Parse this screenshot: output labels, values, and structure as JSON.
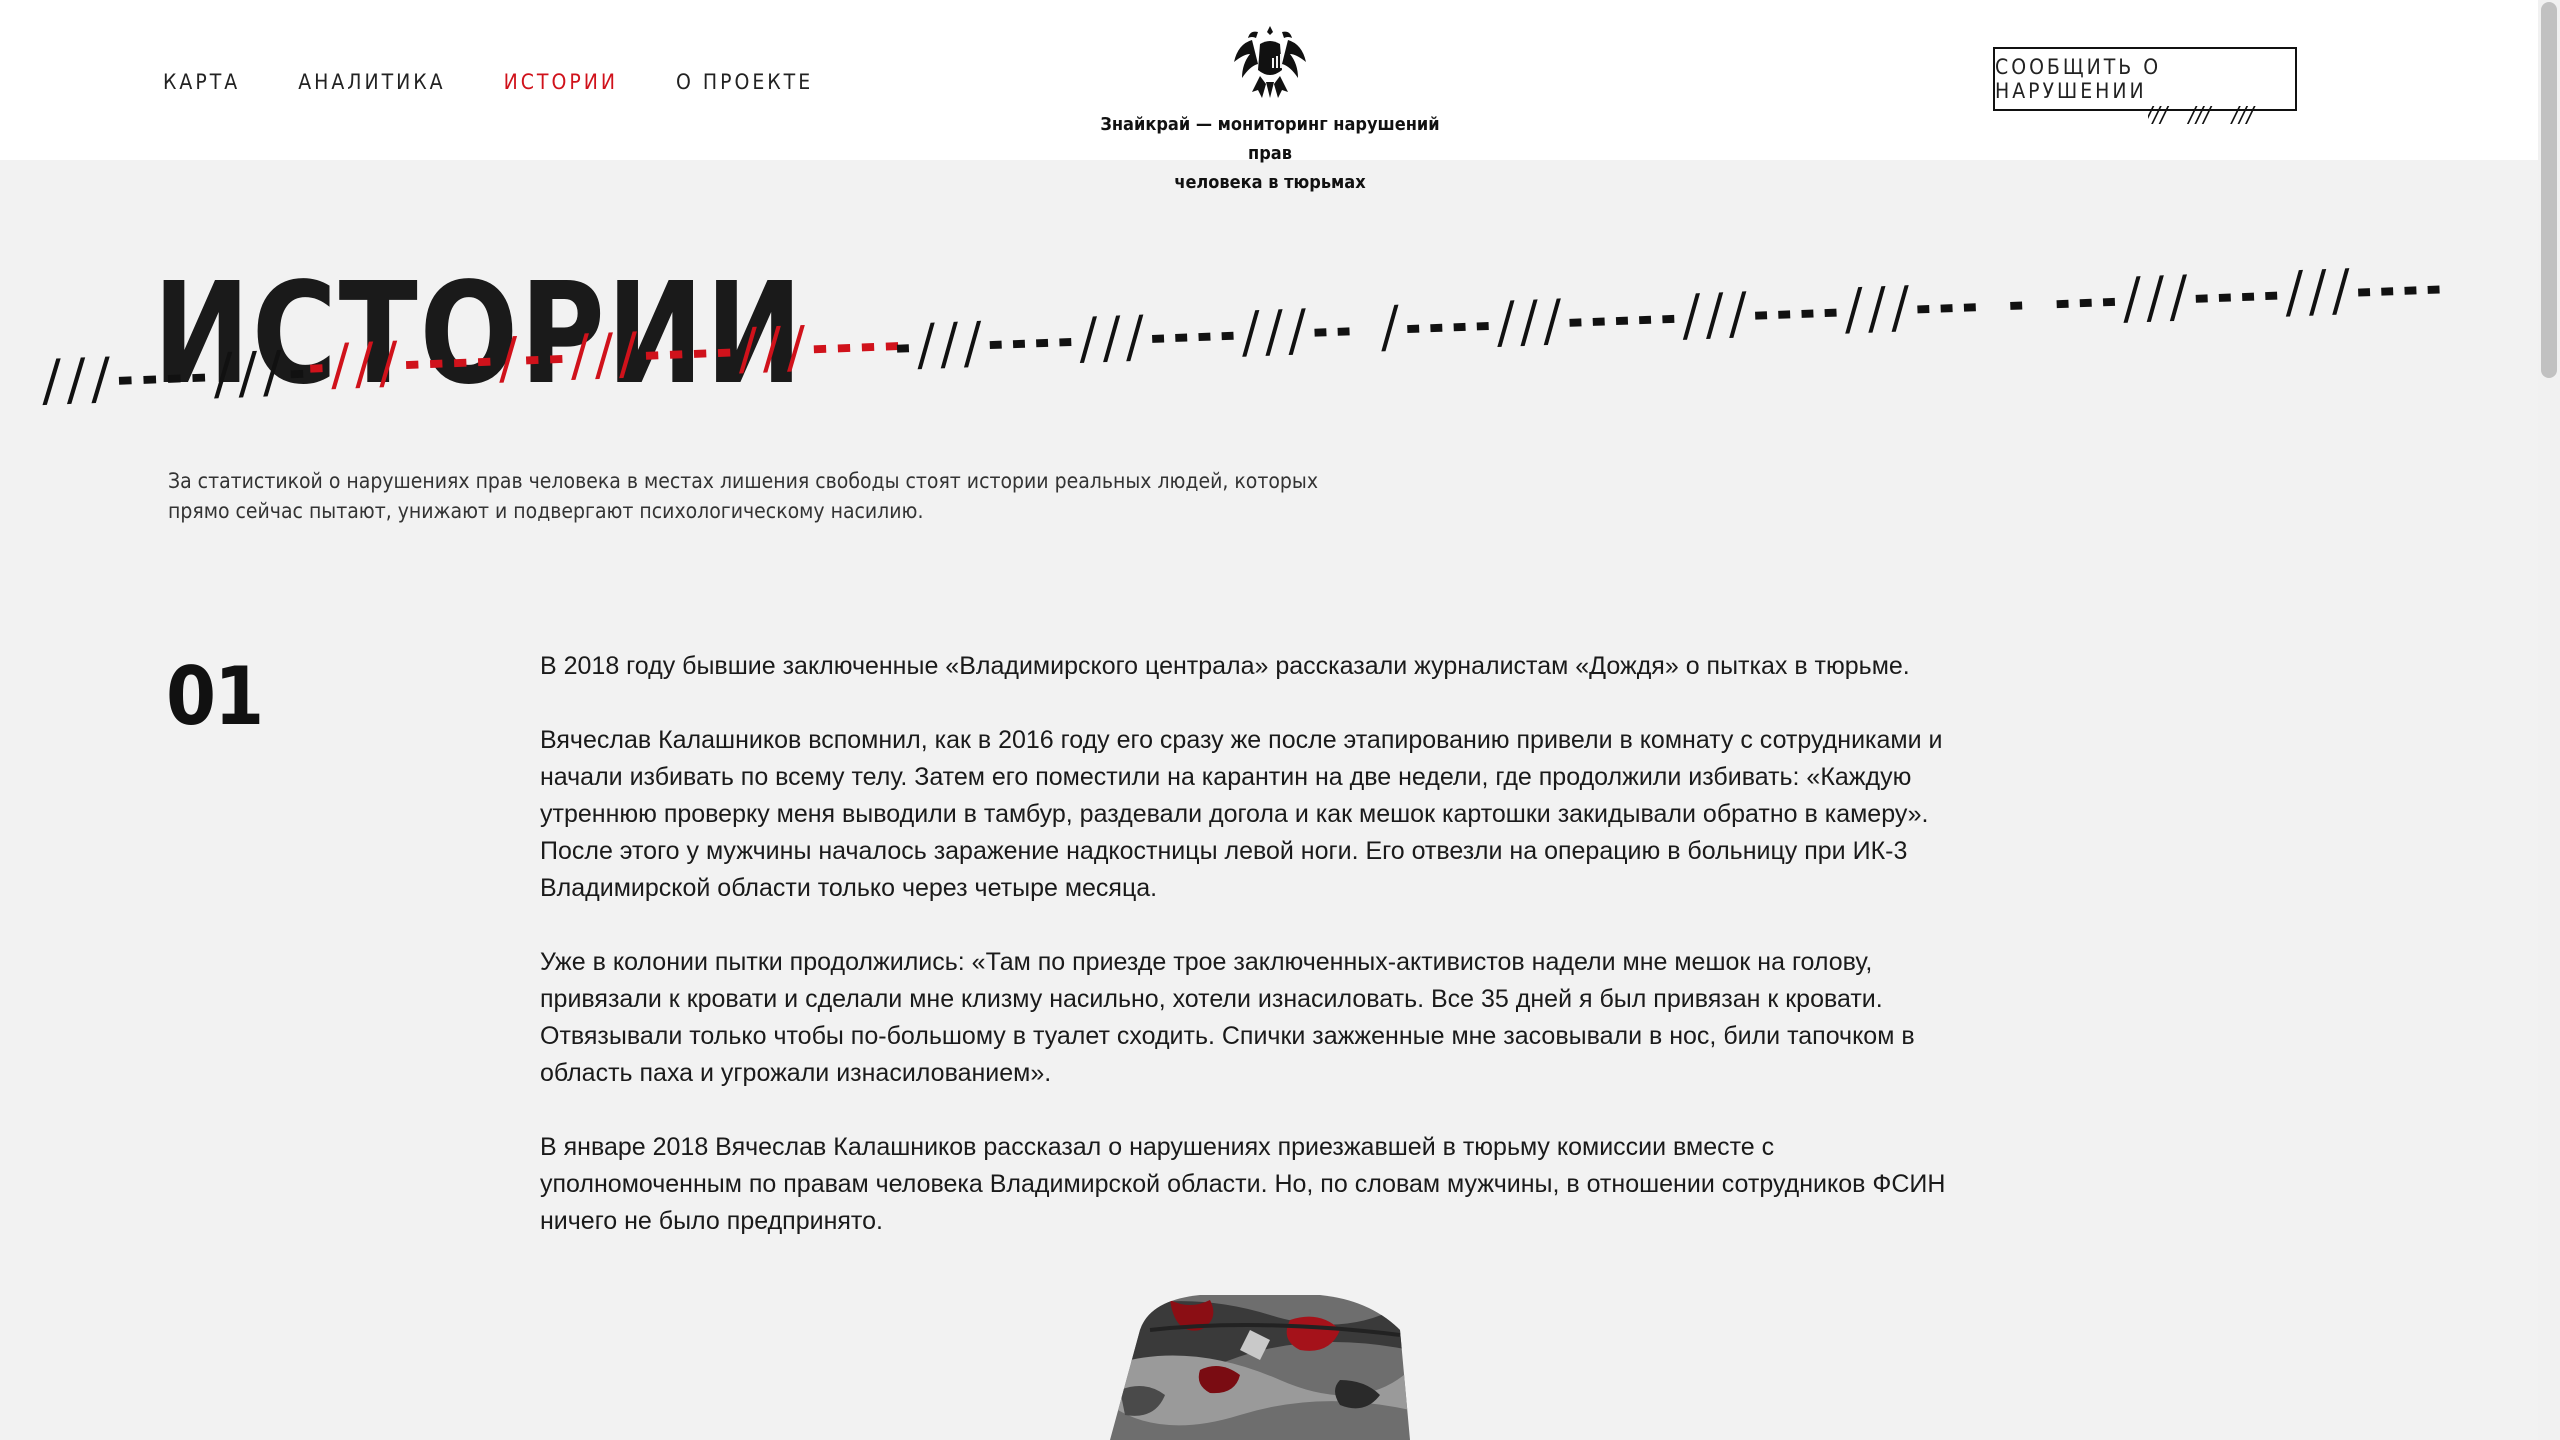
{
  "nav": {
    "items": [
      {
        "label": "КАРТА",
        "active": false
      },
      {
        "label": "АНАЛИТИКА",
        "active": false
      },
      {
        "label": "ИСТОРИИ",
        "active": true
      },
      {
        "label": "О ПРОЕКТЕ",
        "active": false
      }
    ]
  },
  "logo": {
    "icon": "double-headed-eagle-icon",
    "line1": "Знайкрай — мониторинг нарушений прав",
    "line2": "человека в тюрьмах"
  },
  "header": {
    "report_button": "СООБЩИТЬ О НАРУШЕНИИ",
    "button_decoration": "///   ///   ///"
  },
  "hero": {
    "title": "ИСТОРИИ",
    "slash_segments": [
      {
        "text": "///----///-",
        "color": "#111111"
      },
      {
        "text": "-///----/--///----///----",
        "color": "#d0121b"
      },
      {
        "text": "-///----///----///-- /----///-----///----///--- - ---///----///----",
        "color": "#111111"
      }
    ],
    "intro": "За статистикой о нарушениях прав человека в местах лишения свободы стоят истории реальных людей, которых прямо сейчас пытают, унижают и подвергают психологическому насилию."
  },
  "story": {
    "number": "01",
    "paragraphs": [
      "В 2018 году бывшие заключенные «Владимирского централа» рассказали журналистам «Дождя» о пытках в тюрьме.",
      "Вячеслав Калашников вспомнил, как в 2016 году его сразу же после этапированию привели в комнату с сотрудниками и начали избивать по всему телу. Затем его поместили на карантин на две недели, где продолжили избивать: «Каждую утреннюю проверку меня выводили в тамбур, раздевали догола и как мешок картошки закидывали обратно в камеру». После этого у мужчины началось заражение надкостницы левой ноги. Его отвезли на операцию в больницу при ИК-3 Владимирской области только через четыре месяца.",
      "Уже в колонии пытки продолжились: «Там по приезде трое заключенных-активистов надели мне мешок на голову, привязали к кровати и сделали мне клизму насильно, хотели изнасиловать. Все 35 дней я был привязан к кровати. Отвязывали только чтобы по-большому в туалет сходить. Спички зажженные мне засовывали в нос, били тапочком в область паха и угрожали изнасилованием».",
      "В январе 2018 Вячеслав Калашников рассказал о нарушениях приезжавшей в тюрьму комиссии вместе с уполномоченным по правам человека Владимирской области. Но, по словам мужчины, в отношении сотрудников ФСИН ничего не было предпринято."
    ]
  },
  "colors": {
    "accent": "#d0121b",
    "text": "#111111",
    "background": "#f2f2f2",
    "header_bg": "#ffffff"
  }
}
